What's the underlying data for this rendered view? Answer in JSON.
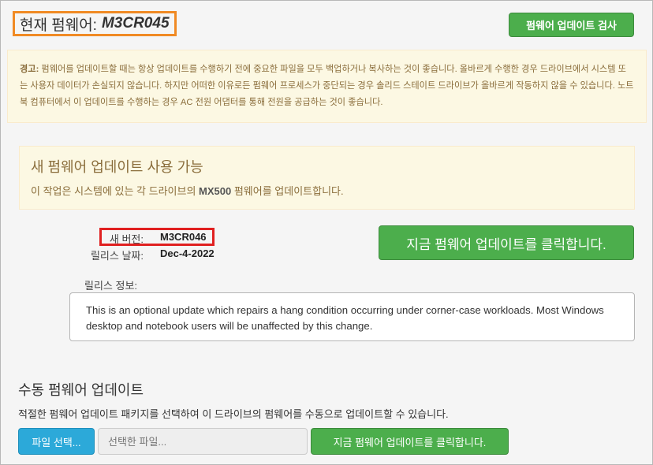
{
  "header": {
    "current_label": "현재 펌웨어:",
    "current_version": "M3CR045",
    "check_button": "펌웨어 업데이트 검사"
  },
  "warning": {
    "prefix": "경고:",
    "text": " 펌웨어를 업데이트할 때는 항상 업데이트를 수행하기 전에 중요한 파일을 모두 백업하거나 복사하는 것이 좋습니다. 올바르게 수행한 경우 드라이브에서 시스템 또는 사용자 데이터가 손실되지 않습니다. 하지만 어떠한 이유로든 펌웨어 프로세스가 중단되는 경우 솔리드 스테이트 드라이브가 올바르게 작동하지 않을 수 있습니다. 노트북 컴퓨터에서 이 업데이트를 수행하는 경우 AC 전원 어댑터를 통해 전원을 공급하는 것이 좋습니다."
  },
  "available": {
    "title": "새 펌웨어 업데이트 사용 가능",
    "desc_before": "이 작업은 시스템에 있는 각 드라이브의 ",
    "desc_model": "MX500",
    "desc_after": " 펌웨어를 업데이트합니다."
  },
  "version_info": {
    "new_version_label": "새 버전:",
    "new_version": "M3CR046",
    "release_date_label": "릴리스 날짜:",
    "release_date": "Dec-4-2022",
    "release_info_label": "릴리스 정보:",
    "release_notes": "This is an optional update which repairs a hang condition occurring under corner-case workloads. Most Windows desktop and notebook users will be unaffected by this change.",
    "update_now_button": "지금 펌웨어 업데이트를 클릭합니다."
  },
  "manual": {
    "title": "수동 펌웨어 업데이트",
    "desc": "적절한 펌웨어 업데이트 패키지를 선택하여 이 드라이브의 펌웨어를 수동으로 업데이트할 수 있습니다.",
    "file_button": "파일 선택...",
    "file_placeholder": "선택한 파일...",
    "update_now_button": "지금 펌웨어 업데이트를 클릭합니다."
  }
}
